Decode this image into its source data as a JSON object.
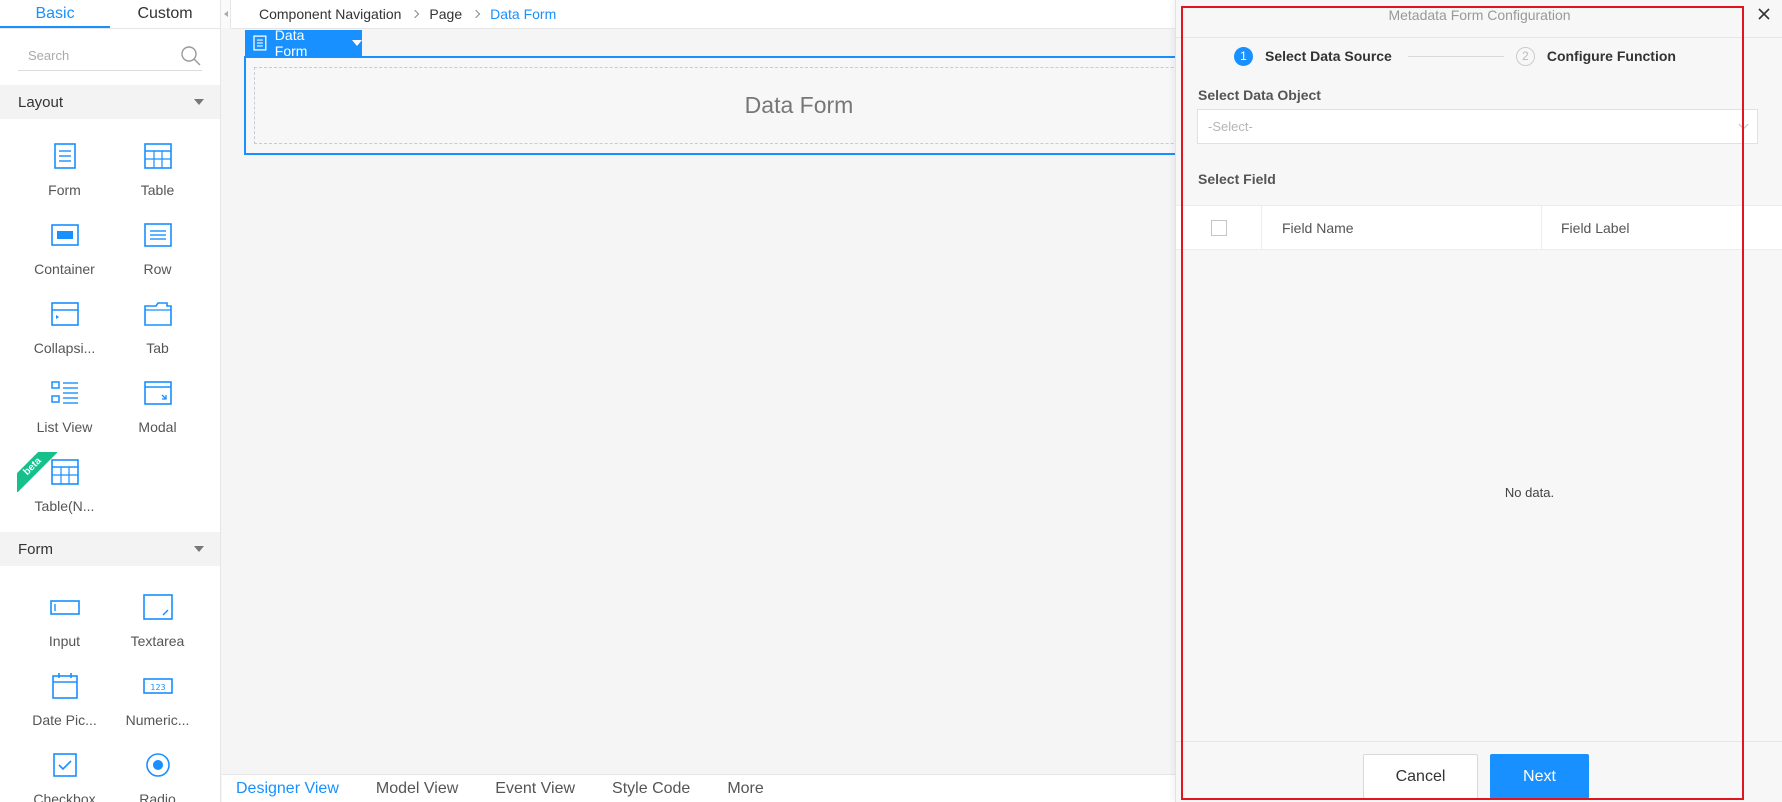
{
  "left_panel": {
    "tabs": [
      "Basic",
      "Custom"
    ],
    "search_placeholder": "Search",
    "sections": {
      "layout": {
        "title": "Layout",
        "items": [
          {
            "label": "Form",
            "icon": "form-icon"
          },
          {
            "label": "Table",
            "icon": "table-icon"
          },
          {
            "label": "Container",
            "icon": "container-icon"
          },
          {
            "label": "Row",
            "icon": "row-icon"
          },
          {
            "label": "Collapsi...",
            "icon": "collapse-icon"
          },
          {
            "label": "Tab",
            "icon": "tab-icon"
          },
          {
            "label": "List View",
            "icon": "list-view-icon"
          },
          {
            "label": "Modal",
            "icon": "modal-icon"
          },
          {
            "label": "Table(N...",
            "icon": "table-new-icon",
            "badge": "beta"
          }
        ]
      },
      "form": {
        "title": "Form",
        "items": [
          {
            "label": "Input",
            "icon": "input-icon"
          },
          {
            "label": "Textarea",
            "icon": "textarea-icon"
          },
          {
            "label": "Date Pic...",
            "icon": "date-picker-icon"
          },
          {
            "label": "Numeric...",
            "icon": "numeric-icon"
          },
          {
            "label": "Checkbox",
            "icon": "checkbox-icon"
          },
          {
            "label": "Radio",
            "icon": "radio-icon"
          }
        ]
      }
    }
  },
  "breadcrumb": [
    "Component Navigation",
    "Page",
    "Data Form"
  ],
  "canvas": {
    "selected_tag": "Data Form",
    "placeholder": "Data Form"
  },
  "bottom_tabs": [
    "Designer View",
    "Model View",
    "Event View",
    "Style Code",
    "More"
  ],
  "dialog": {
    "title": "Metadata Form Configuration",
    "steps": [
      {
        "num": "1",
        "label": "Select Data Source",
        "active": true
      },
      {
        "num": "2",
        "label": "Configure Function",
        "active": false
      }
    ],
    "select_object_label": "Select Data Object",
    "select_placeholder": "-Select-",
    "select_field_label": "Select Field",
    "columns": [
      "Field Name",
      "Field Label"
    ],
    "empty_text": "No data.",
    "cancel_label": "Cancel",
    "next_label": "Next"
  },
  "colors": {
    "accent": "#1890ff",
    "beta_badge": "#16c08b",
    "highlight_border": "#e0161f"
  }
}
